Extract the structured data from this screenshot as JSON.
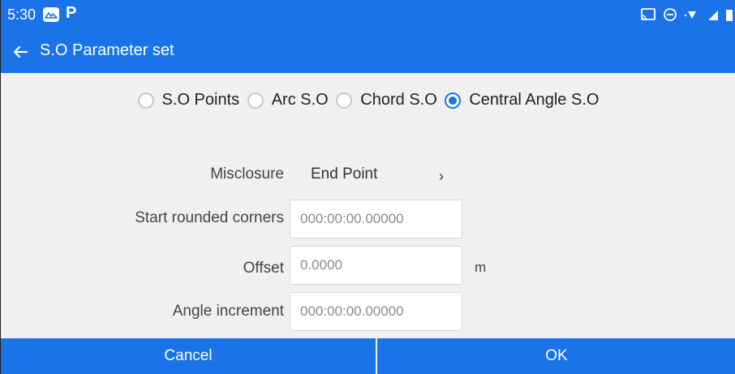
{
  "status_bar": {
    "time": "5:30",
    "p_icon": "P",
    "icons": [
      "cast-icon",
      "dnd-icon",
      "wifi-icon",
      "signal-icon",
      "battery-icon"
    ]
  },
  "header": {
    "title": "S.O Parameter set",
    "back_icon": "back-arrow-icon",
    "color": "#1a73e8"
  },
  "mode_options": [
    {
      "label": "S.O Points",
      "checked": false
    },
    {
      "label": "Arc S.O",
      "checked": false
    },
    {
      "label": "Chord S.O",
      "checked": false
    },
    {
      "label": "Central Angle S.O",
      "checked": true
    }
  ],
  "form": {
    "misclosure_label": "Misclosure",
    "misclosure_value": "End Point",
    "misclosure_chevron": "›",
    "start_corners_label": "Start rounded corners",
    "start_corners_placeholder": "000:00:00.00000",
    "offset_label": "Offset",
    "offset_placeholder": "0.0000",
    "offset_unit": "m",
    "angle_increment_label": "Angle increment",
    "angle_increment_placeholder": "000:00:00.00000"
  },
  "footer": {
    "cancel_label": "Cancel",
    "ok_label": "OK"
  }
}
